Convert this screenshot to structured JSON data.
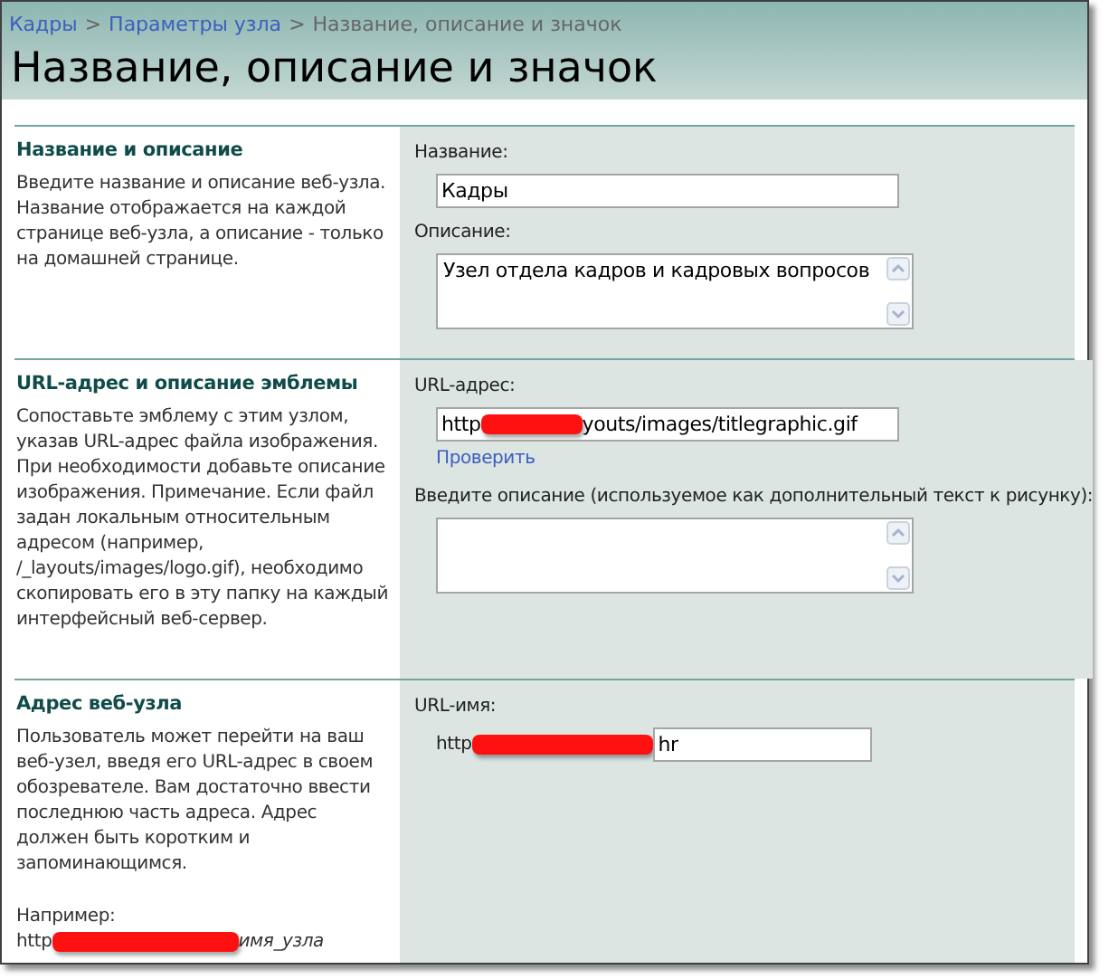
{
  "breadcrumb": [
    {
      "text": "Кадры",
      "kind": "link"
    },
    {
      "text": "Параметры узла",
      "kind": "link"
    },
    {
      "text": "Название, описание и значок",
      "kind": "current"
    }
  ],
  "separator": ">",
  "title": "Название, описание и значок",
  "sections": [
    {
      "heading": "Название и описание",
      "paragraphs": [
        "Введите название и описание веб-узла. Название отображается на каждой странице веб-узла, а описание - только на домашней странице."
      ],
      "fields": [
        {
          "kind": "text",
          "label": "Название:",
          "value": "Кадры"
        },
        {
          "kind": "textarea",
          "label": "Описание:",
          "value": "Узел отдела кадров и кадровых вопросов"
        }
      ]
    },
    {
      "heading": "URL-адрес и описание эмблемы",
      "paragraphs": [
        "Сопоставьте эмблему с этим узлом, указав URL-адрес файла изображения. При необходимости добавьте описание изображения. Примечание. Если файл задан локальным относительным адресом (например, /_layouts/images/logo.gif), необходимо скопировать его в эту папку на каждый интерфейсный веб-сервер."
      ],
      "fields": [
        {
          "kind": "redacted_text",
          "label": "URL-адрес:",
          "value_start": "http",
          "value_end": "youts/images/titlegraphic.gif",
          "link": "Проверить"
        },
        {
          "kind": "textarea",
          "label": "Введите описание (используемое как дополнительный текст к рисунку):"
        }
      ]
    },
    {
      "heading": "Адрес веб-узла",
      "paragraphs": [
        "Пользователь может перейти на ваш веб-узел, введя его URL-адрес в своем обозревателе. Вам достаточно ввести последнюю часть адреса. Адрес должен быть коротким и запоминающимся.",
        "Например:"
      ],
      "example": {
        "start": "http",
        "end": "имя_узла"
      },
      "fields": [
        {
          "kind": "prefixed_text",
          "label": "URL-имя:",
          "prefix": "http",
          "value": "hr"
        }
      ]
    }
  ]
}
